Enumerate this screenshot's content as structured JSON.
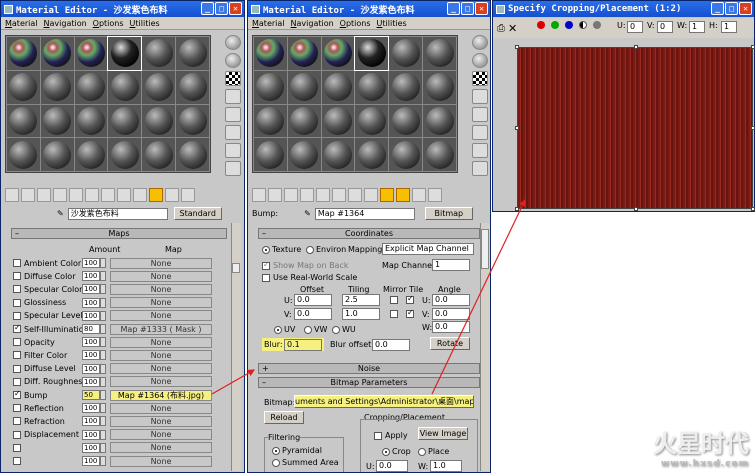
{
  "win1": {
    "title": "Material Editor - 沙发紫色布料",
    "menu": [
      "Material",
      "Navigation",
      "Options",
      "Utilities"
    ],
    "name_value": "沙发紫色布料",
    "type_button": "Standard",
    "maps_header": "Maps",
    "col_amount": "Amount",
    "col_map": "Map",
    "rows": [
      {
        "label": "Ambient Color",
        "amount": "100",
        "map": "None",
        "checked": false
      },
      {
        "label": "Diffuse Color",
        "amount": "100",
        "map": "None",
        "checked": false
      },
      {
        "label": "Specular Color",
        "amount": "100",
        "map": "None",
        "checked": false
      },
      {
        "label": "Glossiness",
        "amount": "100",
        "map": "None",
        "checked": false
      },
      {
        "label": "Specular Level",
        "amount": "100",
        "map": "None",
        "checked": false
      },
      {
        "label": "Self-Illumination",
        "amount": "80",
        "map": "Map #1333  ( Mask )",
        "checked": true
      },
      {
        "label": "Opacity",
        "amount": "100",
        "map": "None",
        "checked": false
      },
      {
        "label": "Filter Color",
        "amount": "100",
        "map": "None",
        "checked": false
      },
      {
        "label": "Diffuse Level",
        "amount": "100",
        "map": "None",
        "checked": false
      },
      {
        "label": "Diff. Roughness",
        "amount": "100",
        "map": "None",
        "checked": false
      },
      {
        "label": "Bump",
        "amount": "50",
        "map": "Map #1364 (布料.jpg)",
        "checked": true
      },
      {
        "label": "Reflection",
        "amount": "100",
        "map": "None",
        "checked": false
      },
      {
        "label": "Refraction",
        "amount": "100",
        "map": "None",
        "checked": false
      },
      {
        "label": "Displacement",
        "amount": "100",
        "map": "None",
        "checked": false
      },
      {
        "label": "",
        "amount": "100",
        "map": "None",
        "checked": false
      },
      {
        "label": "",
        "amount": "100",
        "map": "None",
        "checked": false
      }
    ]
  },
  "win2": {
    "title": "Material Editor - 沙发紫色布料",
    "menu": [
      "Material",
      "Navigation",
      "Options",
      "Utilities"
    ],
    "bump_label": "Bump:",
    "map_name": "Map #1364",
    "type_button": "Bitmap",
    "coords_header": "Coordinates",
    "texture": "Texture",
    "environ": "Environ",
    "mapping_label": "Mapping:",
    "mapping_value": "Explicit Map Channel",
    "show_map_on_back": "Show Map on Back",
    "map_channel_label": "Map Channel:",
    "map_channel_value": "1",
    "real_world": "Use Real-World Scale",
    "offset": "Offset",
    "tiling": "Tiling",
    "mirror_tile": "Mirror Tile",
    "angle": "Angle",
    "u_label": "U:",
    "v_label": "V:",
    "w_label": "W:",
    "u_offset": "0.0",
    "v_offset": "0.0",
    "u_tiling": "2.5",
    "v_tiling": "1.0",
    "u_angle": "0.0",
    "v_angle": "0.0",
    "w_angle": "0.0",
    "uv": "UV",
    "vw": "VW",
    "wu": "WU",
    "blur_label": "Blur:",
    "blur_value": "0.1",
    "blur_offset_label": "Blur offset:",
    "blur_offset_value": "0.0",
    "rotate": "Rotate",
    "noise_header": "Noise",
    "bitmap_params_header": "Bitmap Parameters",
    "bitmap_label": "Bitmap:",
    "bitmap_path": "uments and Settings\\Administrator\\桌面\\maps\\布料.jpg",
    "reload": "Reload",
    "cropping_label": "Cropping/Placement",
    "apply": "Apply",
    "view_image": "View Image",
    "filtering_label": "Filtering",
    "pyramidal": "Pyramidal",
    "summed_area": "Summed Area",
    "crop": "Crop",
    "place": "Place",
    "crop_u": "0.0",
    "crop_w": "1.0"
  },
  "win3": {
    "title": "Specify Cropping/Placement (1:2)",
    "u_label": "U:",
    "v_label": "V:",
    "w_label": "W:",
    "h_label": "H:",
    "u_val": "0",
    "v_val": "0",
    "w_val": "1",
    "h_val": "1"
  },
  "watermark": {
    "cn": "火星时代",
    "url": "www.hxsd.com"
  },
  "colors": {
    "highlight": "#f6f080",
    "arrow": "#e02020",
    "title_blue": "#1450d0"
  }
}
